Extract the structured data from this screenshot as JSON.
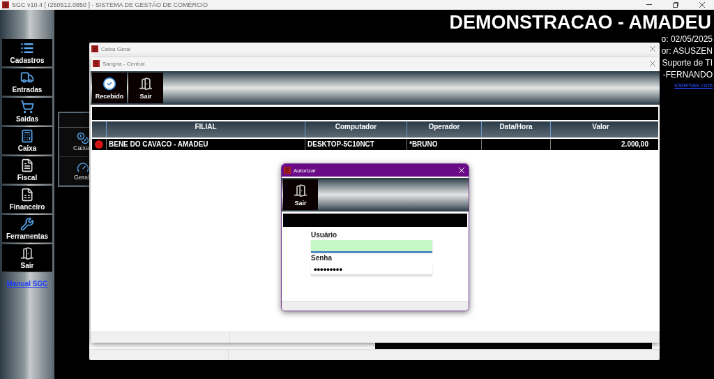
{
  "app": {
    "title": "SGC v10.4 [ r250512.0850 ] - SISTEMA DE GESTÃO DE COMÉRCIO"
  },
  "sidebar": {
    "items": [
      {
        "label": "Cadastros"
      },
      {
        "label": "Entradas"
      },
      {
        "label": "Saidas"
      },
      {
        "label": "Caixa"
      },
      {
        "label": "Fiscal"
      },
      {
        "label": "Financeiro"
      },
      {
        "label": "Ferramentas"
      },
      {
        "label": "Sair"
      }
    ],
    "link": "Manual SGC"
  },
  "banner": {
    "title": "DEMONSTRACAO - AMADEU",
    "info": [
      "o: 02/05/2025",
      "or: ASUSZEN",
      "Suporte de TI",
      "-FERNANDO"
    ],
    "link": "sistemas.com"
  },
  "background_panel": {
    "items": [
      {
        "label": "Caixa"
      },
      {
        "label": "Geral"
      }
    ]
  },
  "caixa_geral": {
    "title": "Caixa Geral"
  },
  "sangria": {
    "title": "Sangria - Central",
    "toolbar": [
      {
        "label": "Recebido"
      },
      {
        "label": "Sair"
      }
    ],
    "table": {
      "columns": [
        "FILIAL",
        "Computador",
        "Operador",
        "Data/Hora",
        "Valor"
      ],
      "rows": [
        {
          "selected": true,
          "color": "#d41414",
          "cells": [
            "BENE DO CAVACO - AMADEU",
            "DESKTOP-5C10NCT",
            "*BRUNO",
            null,
            "2.000,00"
          ]
        }
      ]
    }
  },
  "dialog": {
    "title": "Autorizar",
    "toolbar": [
      {
        "label": "Sair"
      }
    ],
    "fields": [
      {
        "label": "Usuário",
        "focused": true
      },
      {
        "label": "Senha",
        "value": "•••••••••",
        "focused": false
      }
    ]
  }
}
